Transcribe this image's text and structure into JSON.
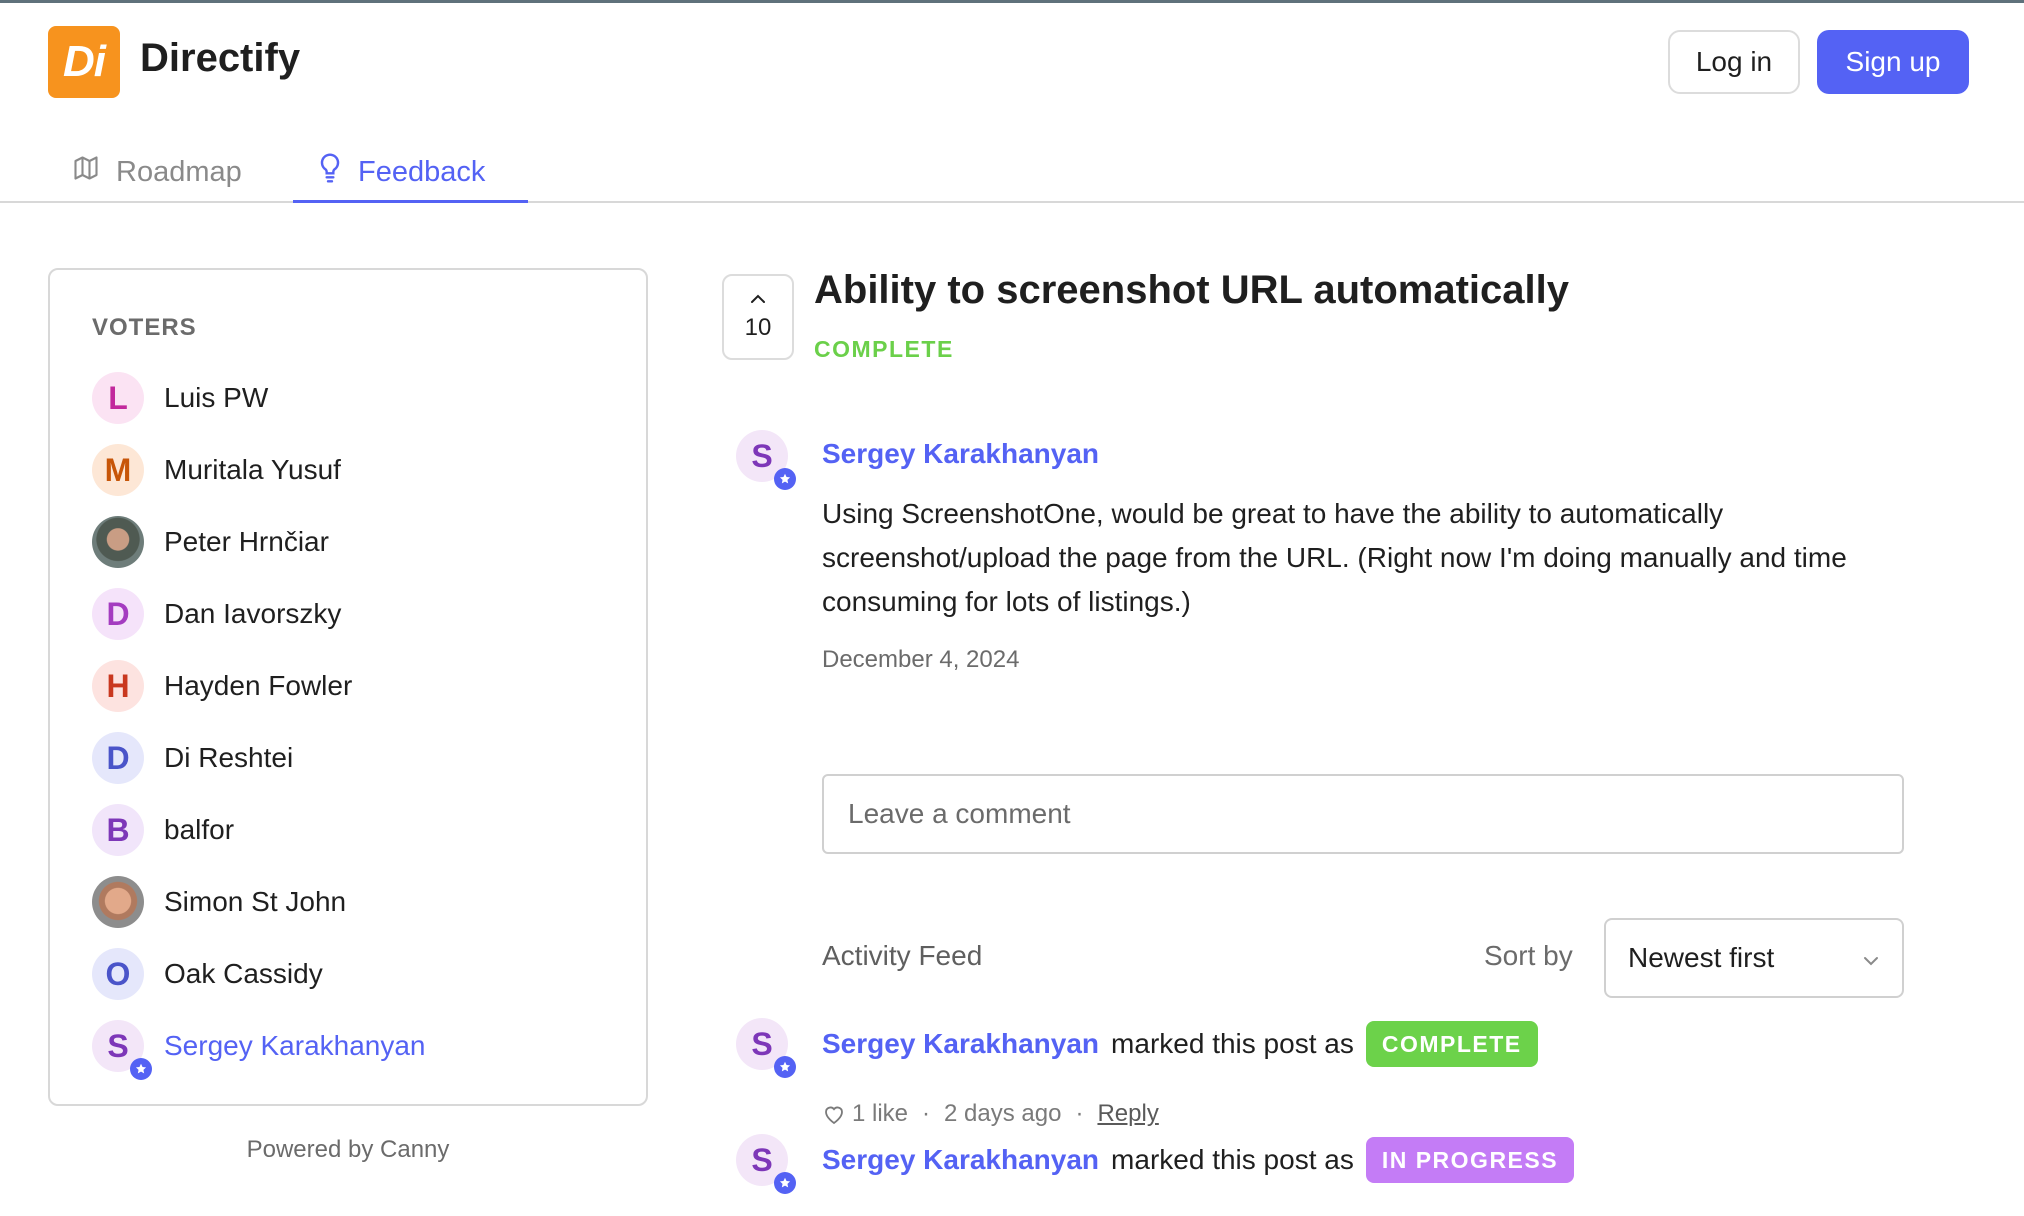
{
  "app": {
    "logo_text": "Di",
    "brand_name": "Directify",
    "brand_color": "#f7931e",
    "accent_color": "#5462f4"
  },
  "header": {
    "login_label": "Log in",
    "signup_label": "Sign up"
  },
  "tabs": [
    {
      "label": "Roadmap",
      "icon": "map-icon",
      "active": false
    },
    {
      "label": "Feedback",
      "icon": "lightbulb-icon",
      "active": true
    }
  ],
  "voters": {
    "title": "VOTERS",
    "items": [
      {
        "name": "Luis PW",
        "initial": "L",
        "bg": "#fbe3f3",
        "fg": "#c2289c",
        "photo": false,
        "admin": false
      },
      {
        "name": "Muritala Yusuf",
        "initial": "M",
        "bg": "#fde7d6",
        "fg": "#c75609",
        "photo": false,
        "admin": false
      },
      {
        "name": "Peter Hrnčiar",
        "initial": "",
        "photo": true,
        "admin": false
      },
      {
        "name": "Dan Iavorszky",
        "initial": "D",
        "bg": "#f5e3fa",
        "fg": "#a43cc0",
        "photo": false,
        "admin": false
      },
      {
        "name": "Hayden Fowler",
        "initial": "H",
        "bg": "#fde3e0",
        "fg": "#c9381f",
        "photo": false,
        "admin": false
      },
      {
        "name": "Di Reshtei",
        "initial": "D",
        "bg": "#e5e7fb",
        "fg": "#4a54c9",
        "photo": false,
        "admin": false
      },
      {
        "name": "balfor",
        "initial": "B",
        "bg": "#f1e5fa",
        "fg": "#7d37b8",
        "photo": false,
        "admin": false
      },
      {
        "name": "Simon St John",
        "initial": "",
        "photo": true,
        "admin": false
      },
      {
        "name": "Oak Cassidy",
        "initial": "O",
        "bg": "#e5e7fb",
        "fg": "#4a54c9",
        "photo": false,
        "admin": false
      },
      {
        "name": "Sergey Karakhanyan",
        "initial": "S",
        "bg": "#f3e6f8",
        "fg": "#7d37b8",
        "photo": false,
        "admin": true
      }
    ]
  },
  "footer": {
    "powered_by": "Powered by Canny"
  },
  "post": {
    "vote_count": "10",
    "title": "Ability to screenshot URL automatically",
    "status": "COMPLETE",
    "status_color": "#6bd04a",
    "author": {
      "name": "Sergey Karakhanyan",
      "initial": "S"
    },
    "body": "Using ScreenshotOne, would be great to have the ability to automatically screenshot/upload the page from the URL. (Right now I'm doing manually and time consuming for lots of listings.)",
    "date": "December 4, 2024"
  },
  "comment": {
    "placeholder": "Leave a comment",
    "value": ""
  },
  "activity_feed": {
    "label": "Activity Feed",
    "sort_label": "Sort by",
    "sort_selected": "Newest first",
    "items": [
      {
        "who": "Sergey Karakhanyan",
        "initial": "S",
        "text": "marked this post as",
        "status": "COMPLETE",
        "status_color": "#6cd24a",
        "likes": "1 like",
        "time": "2 days ago",
        "reply_label": "Reply"
      },
      {
        "who": "Sergey Karakhanyan",
        "initial": "S",
        "text": "marked this post as",
        "status": "IN PROGRESS",
        "status_color": "#c47cf6"
      }
    ]
  }
}
